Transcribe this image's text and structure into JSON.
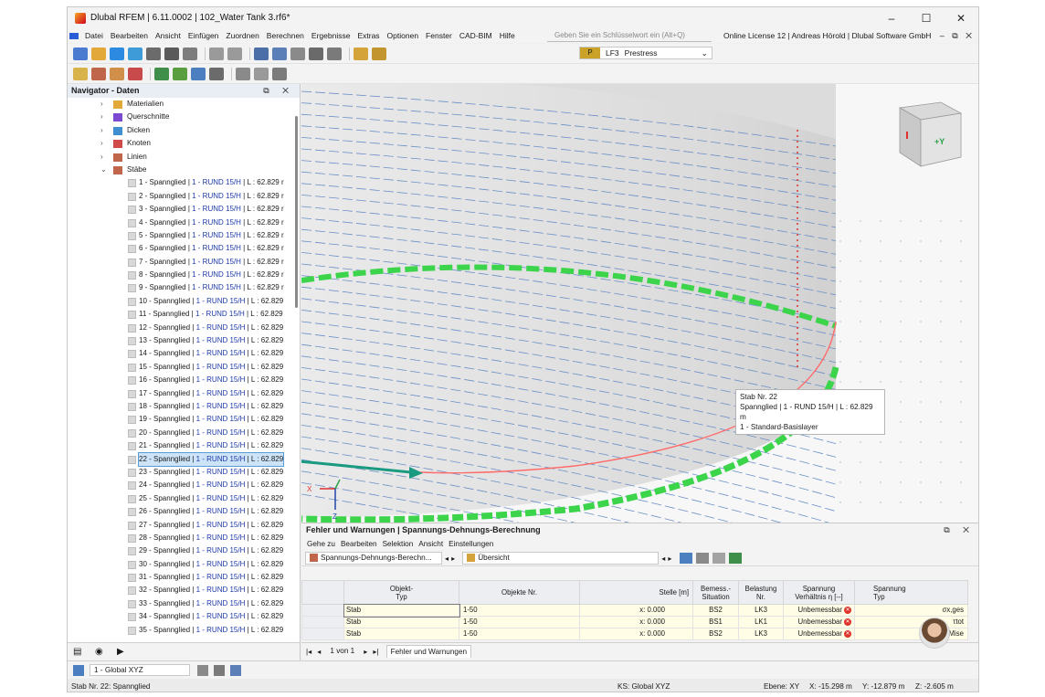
{
  "window": {
    "title": "Dlubal RFEM | 6.11.0002 | 102_Water Tank 3.rf6*",
    "controls": [
      "–",
      "☐",
      "✕"
    ]
  },
  "menu": {
    "items": [
      "Datei",
      "Bearbeiten",
      "Ansicht",
      "Einfügen",
      "Zuordnen",
      "Berechnen",
      "Ergebnisse",
      "Extras",
      "Optionen",
      "Fenster",
      "CAD-BIM",
      "Hilfe"
    ],
    "search_placeholder": "Geben Sie ein Schlüsselwort ein (Alt+Q)",
    "license": "Online License 12 | Andreas Hörold | Dlubal Software GmbH",
    "right_controls": "– ⧉ ✕"
  },
  "loadcase": {
    "tag": "P",
    "id": "LF3",
    "name": "Prestress"
  },
  "navigator": {
    "title": "Navigator - Daten",
    "controls": "⧉ ✕",
    "tree": [
      {
        "label": "Materialien",
        "chev": "›"
      },
      {
        "label": "Querschnitte",
        "chev": "›"
      },
      {
        "label": "Dicken",
        "chev": "›"
      },
      {
        "label": "Knoten",
        "chev": "›"
      },
      {
        "label": "Linien",
        "chev": "›"
      },
      {
        "label": "Stäbe",
        "chev": "⌄"
      }
    ],
    "members": [
      {
        "prefix": "1 - Spannglied | ",
        "sec": "1 - RUND 15/H",
        "suffix": " | L : 62.829 r"
      },
      {
        "prefix": "2 - Spannglied | ",
        "sec": "1 - RUND 15/H",
        "suffix": " | L : 62.829 r"
      },
      {
        "prefix": "3 - Spannglied | ",
        "sec": "1 - RUND 15/H",
        "suffix": " | L : 62.829 r"
      },
      {
        "prefix": "4 - Spannglied | ",
        "sec": "1 - RUND 15/H",
        "suffix": " | L : 62.829 r"
      },
      {
        "prefix": "5 - Spannglied | ",
        "sec": "1 - RUND 15/H",
        "suffix": " | L : 62.829 r"
      },
      {
        "prefix": "6 - Spannglied | ",
        "sec": "1 - RUND 15/H",
        "suffix": " | L : 62.829 r"
      },
      {
        "prefix": "7 - Spannglied | ",
        "sec": "1 - RUND 15/H",
        "suffix": " | L : 62.829 r"
      },
      {
        "prefix": "8 - Spannglied | ",
        "sec": "1 - RUND 15/H",
        "suffix": " | L : 62.829 r"
      },
      {
        "prefix": "9 - Spannglied | ",
        "sec": "1 - RUND 15/H",
        "suffix": " | L : 62.829 r"
      },
      {
        "prefix": "10 - Spannglied | ",
        "sec": "1 - RUND 15/H",
        "suffix": " | L : 62.829"
      },
      {
        "prefix": "11 - Spannglied | ",
        "sec": "1 - RUND 15/H",
        "suffix": " | L : 62.829"
      },
      {
        "prefix": "12 - Spannglied | ",
        "sec": "1 - RUND 15/H",
        "suffix": " | L : 62.829"
      },
      {
        "prefix": "13 - Spannglied | ",
        "sec": "1 - RUND 15/H",
        "suffix": " | L : 62.829"
      },
      {
        "prefix": "14 - Spannglied | ",
        "sec": "1 - RUND 15/H",
        "suffix": " | L : 62.829"
      },
      {
        "prefix": "15 - Spannglied | ",
        "sec": "1 - RUND 15/H",
        "suffix": " | L : 62.829"
      },
      {
        "prefix": "16 - Spannglied | ",
        "sec": "1 - RUND 15/H",
        "suffix": " | L : 62.829"
      },
      {
        "prefix": "17 - Spannglied | ",
        "sec": "1 - RUND 15/H",
        "suffix": " | L : 62.829"
      },
      {
        "prefix": "18 - Spannglied | ",
        "sec": "1 - RUND 15/H",
        "suffix": " | L : 62.829"
      },
      {
        "prefix": "19 - Spannglied | ",
        "sec": "1 - RUND 15/H",
        "suffix": " | L : 62.829"
      },
      {
        "prefix": "20 - Spannglied | ",
        "sec": "1 - RUND 15/H",
        "suffix": " | L : 62.829"
      },
      {
        "prefix": "21 - Spannglied | ",
        "sec": "1 - RUND 15/H",
        "suffix": " | L : 62.829"
      },
      {
        "prefix": "22 - Spannglied | ",
        "sec": "1 - RUND 15/H",
        "suffix": " | L : 62.829",
        "selected": true
      },
      {
        "prefix": "23 - Spannglied | ",
        "sec": "1 - RUND 15/H",
        "suffix": " | L : 62.829"
      },
      {
        "prefix": "24 - Spannglied | ",
        "sec": "1 - RUND 15/H",
        "suffix": " | L : 62.829"
      },
      {
        "prefix": "25 - Spannglied | ",
        "sec": "1 - RUND 15/H",
        "suffix": " | L : 62.829"
      },
      {
        "prefix": "26 - Spannglied | ",
        "sec": "1 - RUND 15/H",
        "suffix": " | L : 62.829"
      },
      {
        "prefix": "27 - Spannglied | ",
        "sec": "1 - RUND 15/H",
        "suffix": " | L : 62.829"
      },
      {
        "prefix": "28 - Spannglied | ",
        "sec": "1 - RUND 15/H",
        "suffix": " | L : 62.829"
      },
      {
        "prefix": "29 - Spannglied | ",
        "sec": "1 - RUND 15/H",
        "suffix": " | L : 62.829"
      },
      {
        "prefix": "30 - Spannglied | ",
        "sec": "1 - RUND 15/H",
        "suffix": " | L : 62.829"
      },
      {
        "prefix": "31 - Spannglied | ",
        "sec": "1 - RUND 15/H",
        "suffix": " | L : 62.829"
      },
      {
        "prefix": "32 - Spannglied | ",
        "sec": "1 - RUND 15/H",
        "suffix": " | L : 62.829"
      },
      {
        "prefix": "33 - Spannglied | ",
        "sec": "1 - RUND 15/H",
        "suffix": " | L : 62.829"
      },
      {
        "prefix": "34 - Spannglied | ",
        "sec": "1 - RUND 15/H",
        "suffix": " | L : 62.829"
      },
      {
        "prefix": "35 - Spannglied | ",
        "sec": "1 - RUND 15/H",
        "suffix": " | L : 62.829"
      }
    ]
  },
  "viewport": {
    "cube_label": "+Y",
    "axis_x": "X",
    "axis_z": "Z",
    "tooltip": {
      "line1": "Stab Nr. 22",
      "line2": "Spannglied | 1 - RUND 15/H | L : 62.829 m",
      "line3": "1 - Standard-Basislayer"
    },
    "colors": {
      "support": "#3bd44a",
      "selected_member": "#ff6b6b",
      "arrow": "#1a9a80",
      "tendon": "#6a8fc7"
    }
  },
  "panel": {
    "title": "Fehler und Warnungen | Spannungs-Dehnungs-Berechnung",
    "controls": "⧉ ✕",
    "menu": [
      "Gehe zu",
      "Bearbeiten",
      "Selektion",
      "Ansicht",
      "Einstellungen"
    ],
    "combo1": "Spannungs-Dehnungs-Berechn...",
    "combo2": "Übersicht",
    "headers": [
      "Objekt-\nTyp",
      "Objekte Nr.",
      "Stelle [m]",
      "Bemess.-\nSituation",
      "Belastung\nNr.",
      "Spannung\nVerhältnis η [--]",
      "Spannung\nTyp"
    ],
    "rows": [
      {
        "type": "Stab",
        "objects": "1-50",
        "loc": "x: 0.000",
        "situation": "BS2",
        "load": "LK3",
        "ratio": "Unbemessbar",
        "stype": "σx,ges"
      },
      {
        "type": "Stab",
        "objects": "1-50",
        "loc": "x: 0.000",
        "situation": "BS1",
        "load": "LK1",
        "ratio": "Unbemessbar",
        "stype": "τtot"
      },
      {
        "type": "Stab",
        "objects": "1-50",
        "loc": "x: 0.000",
        "situation": "BS2",
        "load": "LK3",
        "ratio": "Unbemessbar",
        "stype": "σv,von Mise"
      }
    ],
    "pager": "1 von 1",
    "tab": "Fehler und Warnungen"
  },
  "bottombar": {
    "coord_system": "1 - Global XYZ"
  },
  "status": {
    "left": "Stab Nr. 22: Spannglied",
    "ks": "KS: Global XYZ",
    "plane": "Ebene: XY",
    "x": "X: -15.298 m",
    "y": "Y: -12.879 m",
    "z": "Z: -2.605 m"
  }
}
